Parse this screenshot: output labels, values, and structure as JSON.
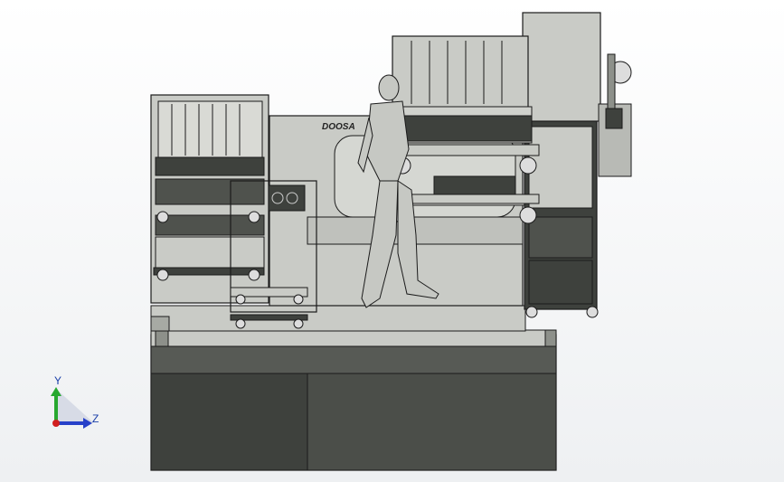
{
  "viewport": {
    "background": "#ffffff",
    "model_color": "#4a4d48",
    "panel_color": "#c9cbc6",
    "edge_color": "#1b1b1b",
    "brand_text": "DOOSA"
  },
  "axes": {
    "y_label": "Y",
    "z_label": "Z",
    "y_color": "#27a82f",
    "z_color": "#2741c9",
    "origin_color": "#d11f1f"
  }
}
